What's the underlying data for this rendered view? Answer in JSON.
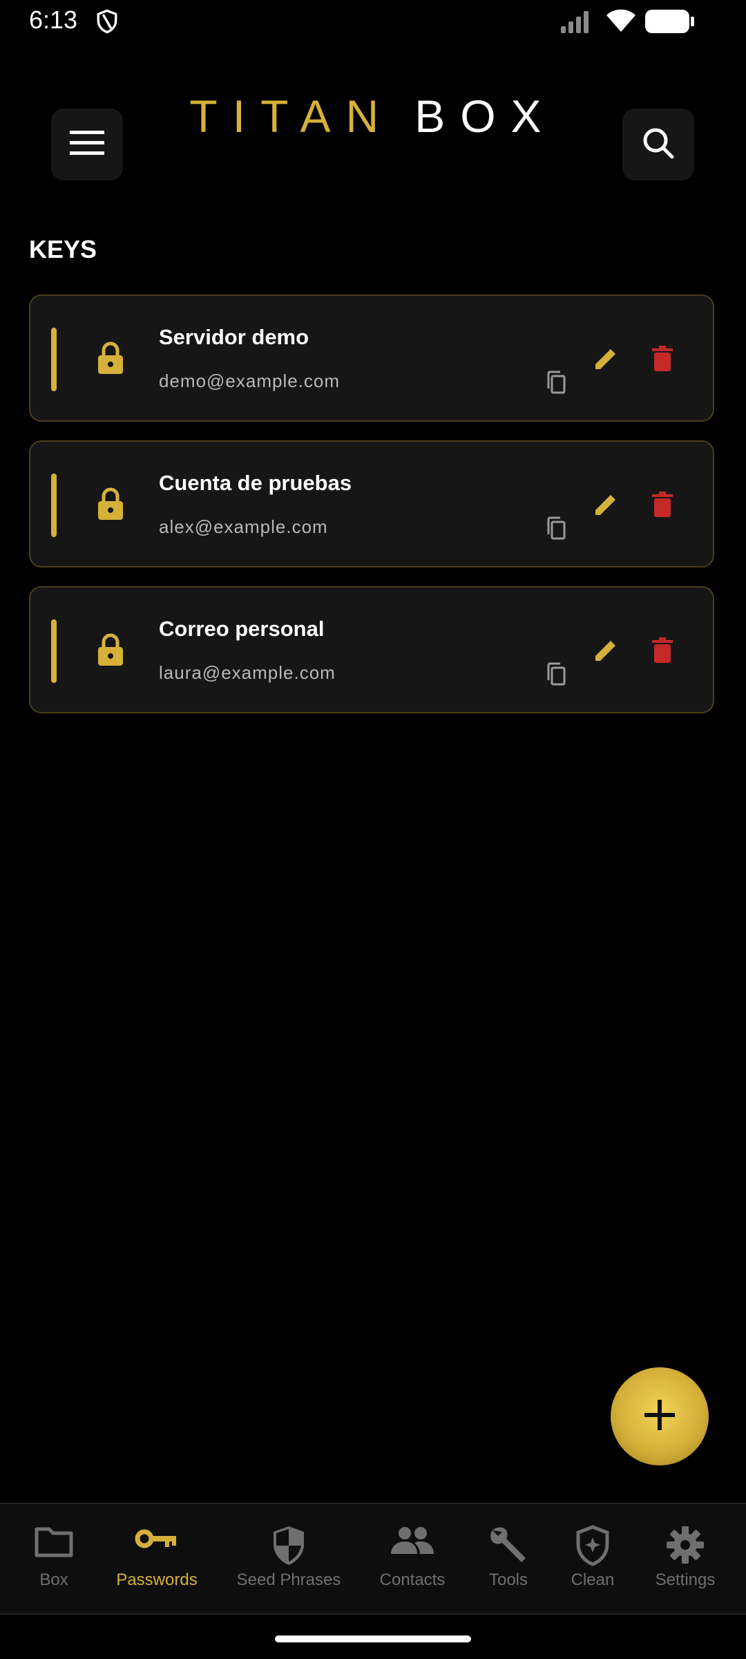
{
  "status_bar": {
    "time": "6:13"
  },
  "header": {
    "logo_primary": "TITAN",
    "logo_secondary": "BOX"
  },
  "section": {
    "title": "KEYS"
  },
  "cards": [
    {
      "title": "Servidor demo",
      "email": "demo@example.com"
    },
    {
      "title": "Cuenta de pruebas",
      "email": "alex@example.com"
    },
    {
      "title": "Correo personal",
      "email": "laura@example.com"
    }
  ],
  "nav": {
    "items": [
      {
        "label": "Box",
        "icon": "folder-icon"
      },
      {
        "label": "Passwords",
        "icon": "key-icon",
        "active": true
      },
      {
        "label": "Seed Phrases",
        "icon": "shield-half-icon"
      },
      {
        "label": "Contacts",
        "icon": "people-icon"
      },
      {
        "label": "Tools",
        "icon": "wrench-icon"
      },
      {
        "label": "Clean",
        "icon": "shield-star-icon"
      },
      {
        "label": "Settings",
        "icon": "gear-icon"
      }
    ]
  },
  "colors": {
    "accent": "#d6b13a",
    "danger": "#c62828",
    "card_bg": "#161616",
    "inactive": "#6f6f6f"
  }
}
